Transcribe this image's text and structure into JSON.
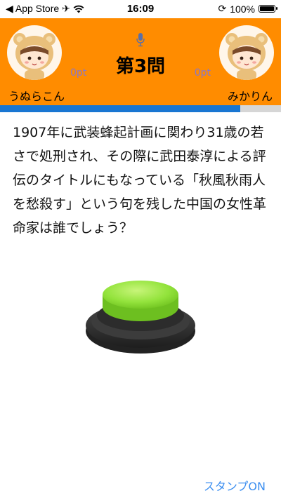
{
  "status_bar": {
    "back_label": "◀ App Store",
    "time": "16:09",
    "battery": "100%"
  },
  "game": {
    "question_number": "第3問",
    "progress": 0.855,
    "player_left": {
      "name": "うぬらこん",
      "points": "0pt"
    },
    "player_right": {
      "name": "みかりん",
      "points": "0pt"
    }
  },
  "question": {
    "text": "1907年に武装蜂起計画に関わり31歳の若さで処刑され、その際に武田泰淳による評伝のタイトルにもなっている「秋風秋雨人を愁殺す」という句を残した中国の女性革命家は誰でしょう？"
  },
  "footer": {
    "stamp_label": "スタンプON"
  },
  "colors": {
    "header": "#ff8c00",
    "progress": "#1976d2",
    "buzzer_top": "#8ee33a",
    "link": "#3b8ef0"
  }
}
